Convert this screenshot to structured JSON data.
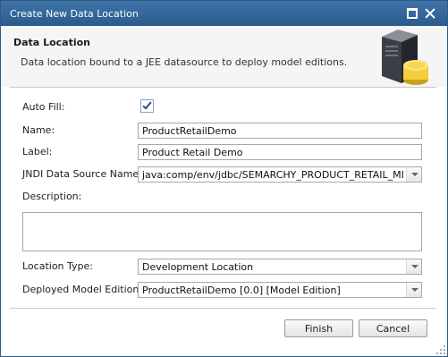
{
  "window": {
    "title": "Create New Data Location"
  },
  "header": {
    "title": "Data Location",
    "description": "Data location bound to a JEE datasource to deploy model editions."
  },
  "form": {
    "auto_fill": {
      "label": "Auto Fill:",
      "checked": true
    },
    "name": {
      "label": "Name:",
      "value": "ProductRetailDemo"
    },
    "label_field": {
      "label": "Label:",
      "value": "Product Retail Demo"
    },
    "jndi": {
      "label": "JNDI Data Source Name:",
      "value": "java:comp/env/jdbc/SEMARCHY_PRODUCT_RETAIL_MDM"
    },
    "description": {
      "label": "Description:",
      "value": ""
    },
    "location_type": {
      "label": "Location Type:",
      "value": "Development Location"
    },
    "deployed_model_edition": {
      "label": "Deployed Model Edition:",
      "value": "ProductRetailDemo [0.0] [Model Edition]"
    }
  },
  "buttons": {
    "finish": "Finish",
    "cancel": "Cancel"
  },
  "icons": {
    "maximize": "maximize-icon",
    "close": "close-icon",
    "database": "database-server-icon",
    "dropdown": "chevron-down-icon",
    "checkmark": "checkmark-icon"
  },
  "colors": {
    "titlebar": "#2b5b8d",
    "header_bg": "#f5f5f5",
    "accent": "#1d4f86"
  }
}
